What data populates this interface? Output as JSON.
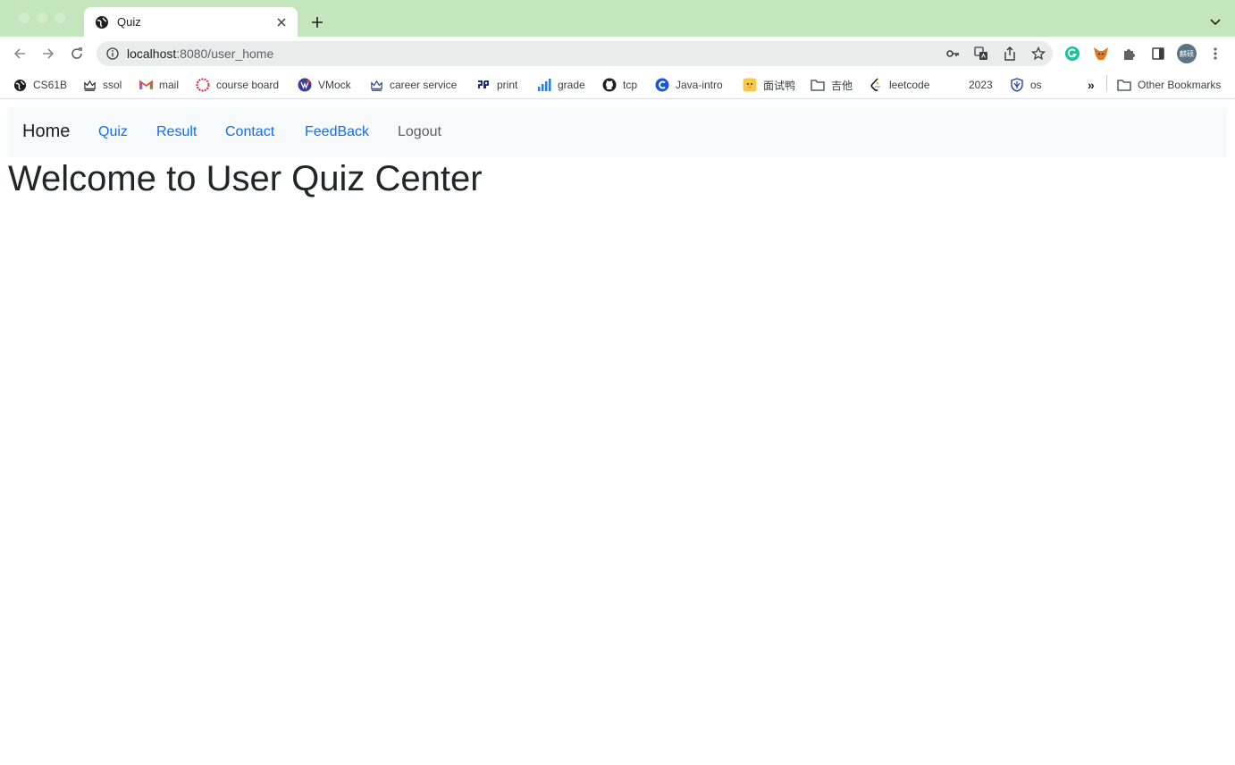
{
  "browser": {
    "tab_title": "Quiz",
    "url_host": "localhost",
    "url_rest": ":8080/user_home",
    "profile_initials": "麒硕",
    "bookmarks": [
      {
        "label": "CS61B",
        "icon": "globe-icon"
      },
      {
        "label": "ssol",
        "icon": "crown-icon"
      },
      {
        "label": "mail",
        "icon": "gmail-icon"
      },
      {
        "label": "course board",
        "icon": "ring-icon"
      },
      {
        "label": "VMock",
        "icon": "vmock-icon"
      },
      {
        "label": "career service",
        "icon": "crown-icon"
      },
      {
        "label": "print",
        "icon": "print-logo-icon"
      },
      {
        "label": "grade",
        "icon": "bars-icon"
      },
      {
        "label": "tcp",
        "icon": "github-icon"
      },
      {
        "label": "Java-intro",
        "icon": "c-logo-icon"
      },
      {
        "label": "面试鸭",
        "icon": "duck-icon"
      },
      {
        "label": "吉他",
        "icon": "folder-icon"
      },
      {
        "label": "leetcode",
        "icon": "leetcode-icon"
      },
      {
        "label": "2023",
        "icon": ""
      },
      {
        "label": "os",
        "icon": "shield-icon"
      }
    ],
    "other_bookmarks": "Other Bookmarks",
    "overflow_label": "»"
  },
  "page": {
    "brand": "Home",
    "nav": [
      "Quiz",
      "Result",
      "Contact",
      "FeedBack",
      "Logout"
    ],
    "heading": "Welcome to User Quiz Center"
  },
  "colors": {
    "tabstrip": "#c3e6bd",
    "link": "#0d6efd",
    "navbar_bg": "#f8f9fa"
  }
}
